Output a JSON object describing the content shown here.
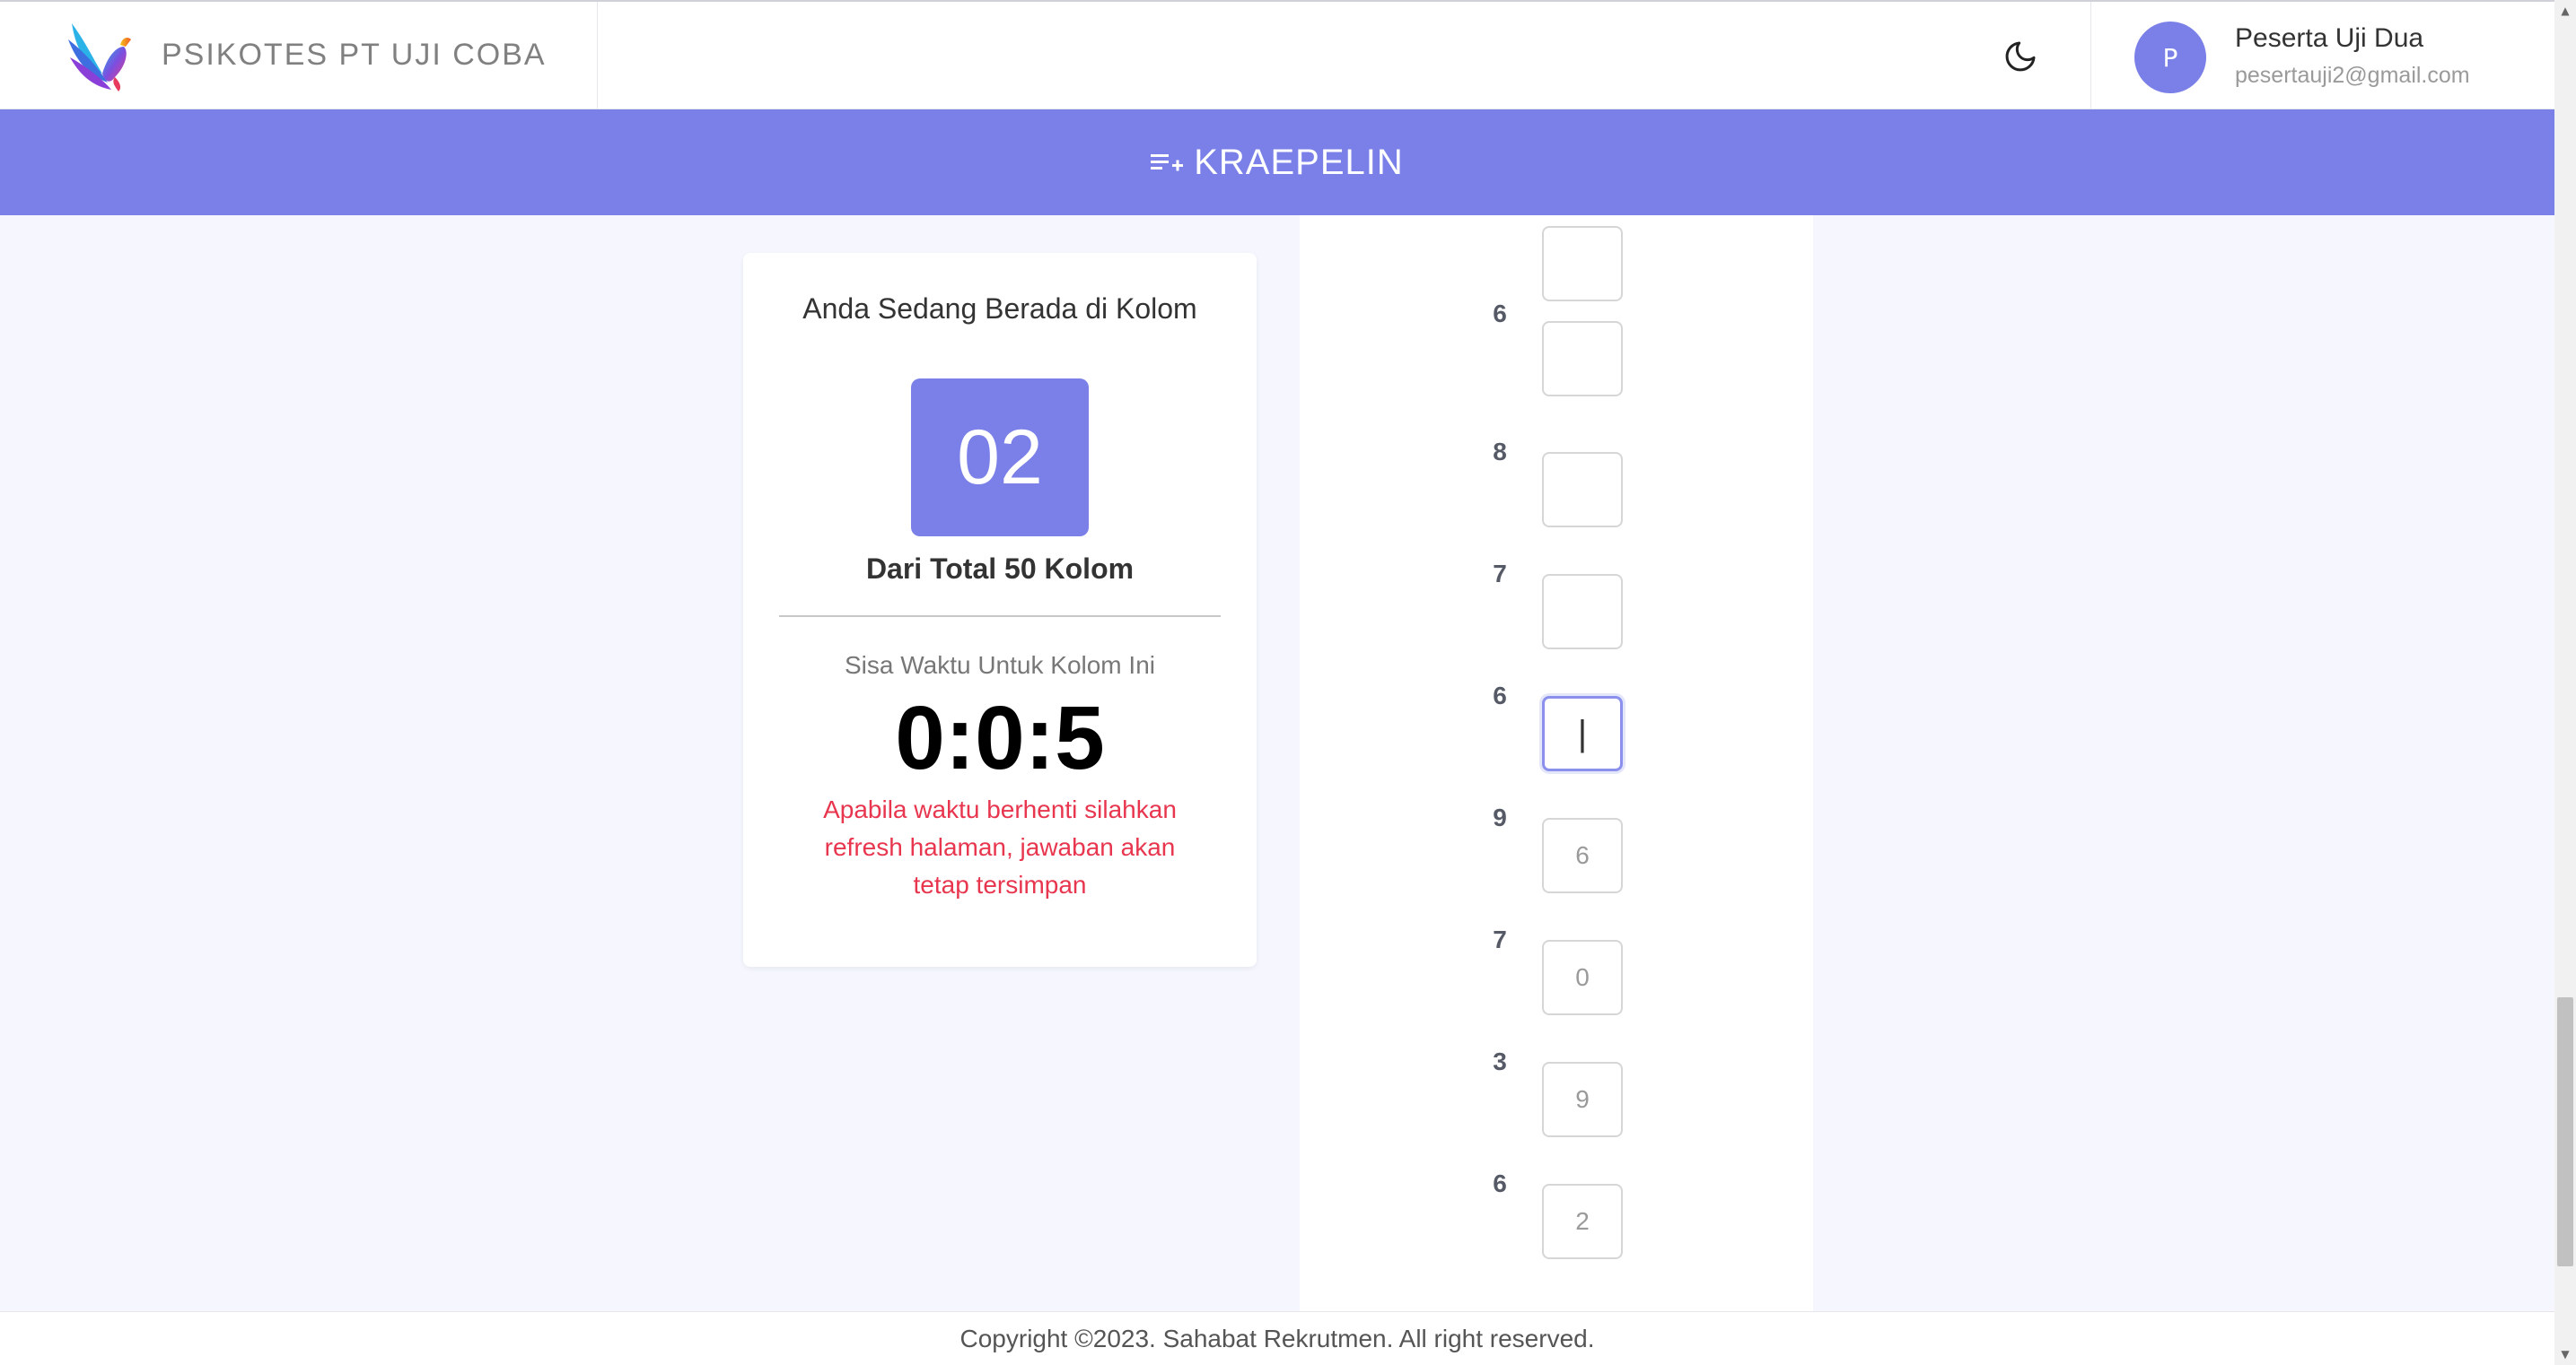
{
  "header": {
    "brand_title": "PSIKOTES PT UJI COBA",
    "user": {
      "initial": "P",
      "name": "Peserta Uji Dua",
      "email": "pesertauji2@gmail.com"
    }
  },
  "band": {
    "title": "KRAEPELIN"
  },
  "info_card": {
    "heading": "Anda Sedang Berada di Kolom",
    "current_column": "02",
    "total_text": "Dari Total 50 Kolom",
    "remaining_label": "Sisa Waktu Untuk Kolom Ini",
    "timer": "0:0:5",
    "warning": "Apabila waktu berhenti silahkan refresh halaman, jawaban akan tetap tersimpan"
  },
  "column": {
    "numbers": [
      "6",
      "8",
      "7",
      "6",
      "9",
      "7",
      "3",
      "6"
    ],
    "answers": [
      "",
      "",
      "",
      "",
      "",
      "6",
      "0",
      "9",
      "2"
    ]
  },
  "footer": {
    "copyright": "Copyright ©2023. Sahabat Rekrutmen. All right reserved."
  },
  "colors": {
    "accent": "#7a80e8",
    "warning": "#e8364f",
    "background": "#f5f6fe"
  }
}
